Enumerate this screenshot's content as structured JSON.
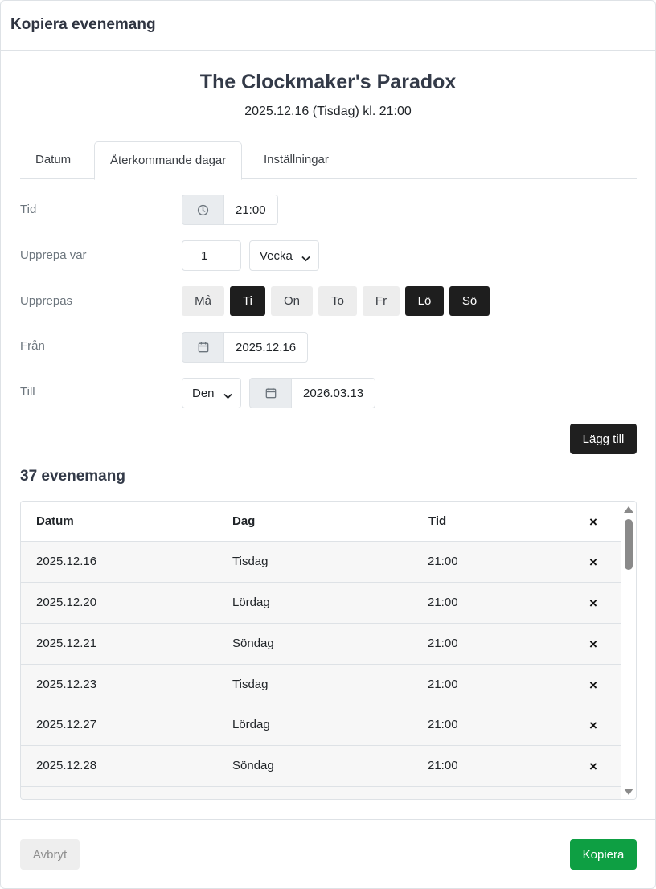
{
  "modal": {
    "title": "Kopiera evenemang"
  },
  "event": {
    "title": "The Clockmaker's Paradox",
    "subtitle": "2025.12.16 (Tisdag) kl. 21:00"
  },
  "tabs": [
    {
      "label": "Datum",
      "active": false
    },
    {
      "label": "Återkommande dagar",
      "active": true
    },
    {
      "label": "Inställningar",
      "active": false
    }
  ],
  "form": {
    "time": {
      "label": "Tid",
      "value": "21:00",
      "icon": "clock-icon"
    },
    "repeat_every": {
      "label": "Upprepa var",
      "value": "1",
      "unit": "Vecka"
    },
    "repeats_on": {
      "label": "Upprepas",
      "days": [
        {
          "label": "Må",
          "selected": false
        },
        {
          "label": "Ti",
          "selected": true
        },
        {
          "label": "On",
          "selected": false
        },
        {
          "label": "To",
          "selected": false
        },
        {
          "label": "Fr",
          "selected": false
        },
        {
          "label": "Lö",
          "selected": true
        },
        {
          "label": "Sö",
          "selected": true
        }
      ]
    },
    "from": {
      "label": "Från",
      "value": "2025.12.16",
      "icon": "calendar-icon"
    },
    "until": {
      "label": "Till",
      "mode": "Den",
      "value": "2026.03.13",
      "icon": "calendar-icon"
    },
    "add_label": "Lägg till"
  },
  "events": {
    "count_label": "37 evenemang",
    "headers": {
      "date": "Datum",
      "day": "Dag",
      "time": "Tid",
      "remove": "×"
    },
    "rows": [
      {
        "date": "2025.12.16",
        "day": "Tisdag",
        "time": "21:00",
        "remove": "×"
      },
      {
        "date": "2025.12.20",
        "day": "Lördag",
        "time": "21:00",
        "remove": "×"
      },
      {
        "date": "2025.12.21",
        "day": "Söndag",
        "time": "21:00",
        "remove": "×"
      },
      {
        "date": "2025.12.23",
        "day": "Tisdag",
        "time": "21:00",
        "remove": "×"
      },
      {
        "date": "2025.12.27",
        "day": "Lördag",
        "time": "21:00",
        "remove": "×"
      },
      {
        "date": "2025.12.28",
        "day": "Söndag",
        "time": "21:00",
        "remove": "×"
      }
    ]
  },
  "footer": {
    "cancel_label": "Avbryt",
    "copy_label": "Kopiera"
  },
  "colors": {
    "primary_dark": "#1e1e1e",
    "success": "#0e9f43",
    "border": "#dee2e6"
  }
}
